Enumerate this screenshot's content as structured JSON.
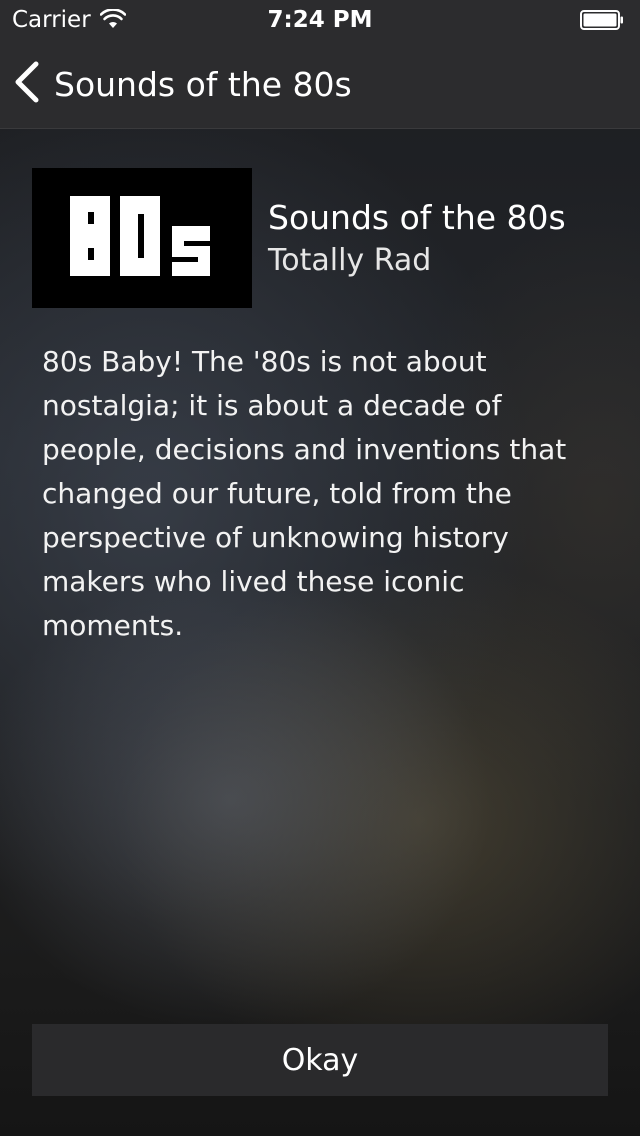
{
  "status_bar": {
    "carrier": "Carrier",
    "time": "7:24 PM",
    "wifi_icon": "wifi-icon",
    "battery_icon": "battery-icon"
  },
  "nav": {
    "back_icon": "chevron-left-icon",
    "back_label": "Sounds of the 80s"
  },
  "album": {
    "artwork_text": "80s",
    "title": "Sounds of the 80s",
    "subtitle": "Totally Rad"
  },
  "description": "80s Baby! The '80s is not about nostalgia; it is about a decade of people, decisions and inventions that changed our future, told from the perspective of unknowing history makers who lived these iconic moments.",
  "actions": {
    "okay_label": "Okay"
  },
  "colors": {
    "nav_background": "#2c2c2e",
    "button_background": "#2a2a2c",
    "text": "#ffffff"
  }
}
